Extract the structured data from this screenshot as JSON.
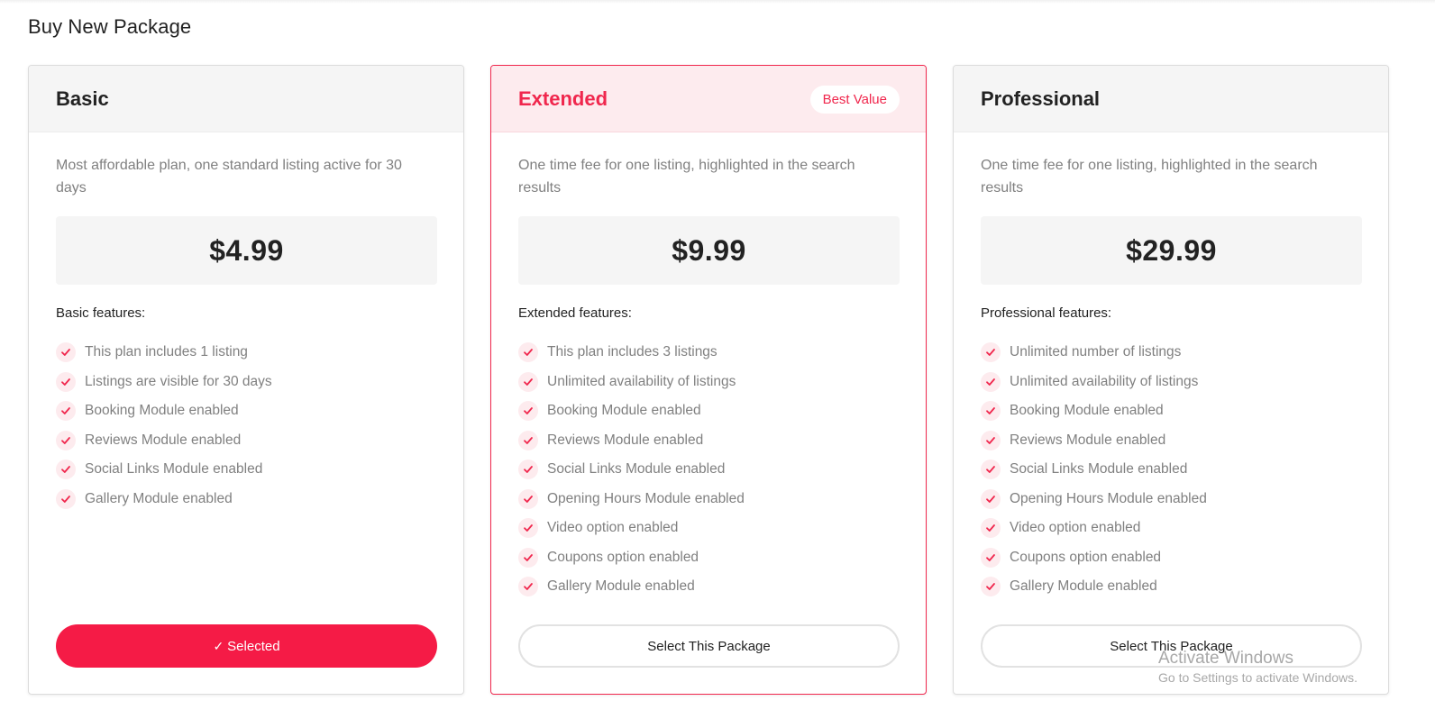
{
  "page": {
    "title": "Buy New Package"
  },
  "colors": {
    "accent": "#f0274d",
    "button_selected": "#f51b46",
    "check_bg": "#fdebee"
  },
  "packages": [
    {
      "name": "Basic",
      "badge": "",
      "description": "Most affordable plan, one standard listing active for 30 days",
      "price": "$4.99",
      "features_label": "Basic features:",
      "features": [
        "This plan includes 1 listing",
        "Listings are visible for 30 days",
        "Booking Module enabled",
        "Reviews Module enabled",
        "Social Links Module enabled",
        "Gallery Module enabled"
      ],
      "button_label": "Selected",
      "selected": true
    },
    {
      "name": "Extended",
      "badge": "Best Value",
      "description": "One time fee for one listing, highlighted in the search results",
      "price": "$9.99",
      "features_label": "Extended features:",
      "features": [
        "This plan includes 3 listings",
        "Unlimited availability of listings",
        "Booking Module enabled",
        "Reviews Module enabled",
        "Social Links Module enabled",
        "Opening Hours Module enabled",
        "Video option enabled",
        "Coupons option enabled",
        "Gallery Module enabled"
      ],
      "button_label": "Select This Package",
      "selected": false
    },
    {
      "name": "Professional",
      "badge": "",
      "description": "One time fee for one listing, highlighted in the search results",
      "price": "$29.99",
      "features_label": "Professional features:",
      "features": [
        "Unlimited number of listings",
        "Unlimited availability of listings",
        "Booking Module enabled",
        "Reviews Module enabled",
        "Social Links Module enabled",
        "Opening Hours Module enabled",
        "Video option enabled",
        "Coupons option enabled",
        "Gallery Module enabled"
      ],
      "button_label": "Select This Package",
      "selected": false
    }
  ],
  "watermark": {
    "title": "Activate Windows",
    "subtitle": "Go to Settings to activate Windows."
  }
}
